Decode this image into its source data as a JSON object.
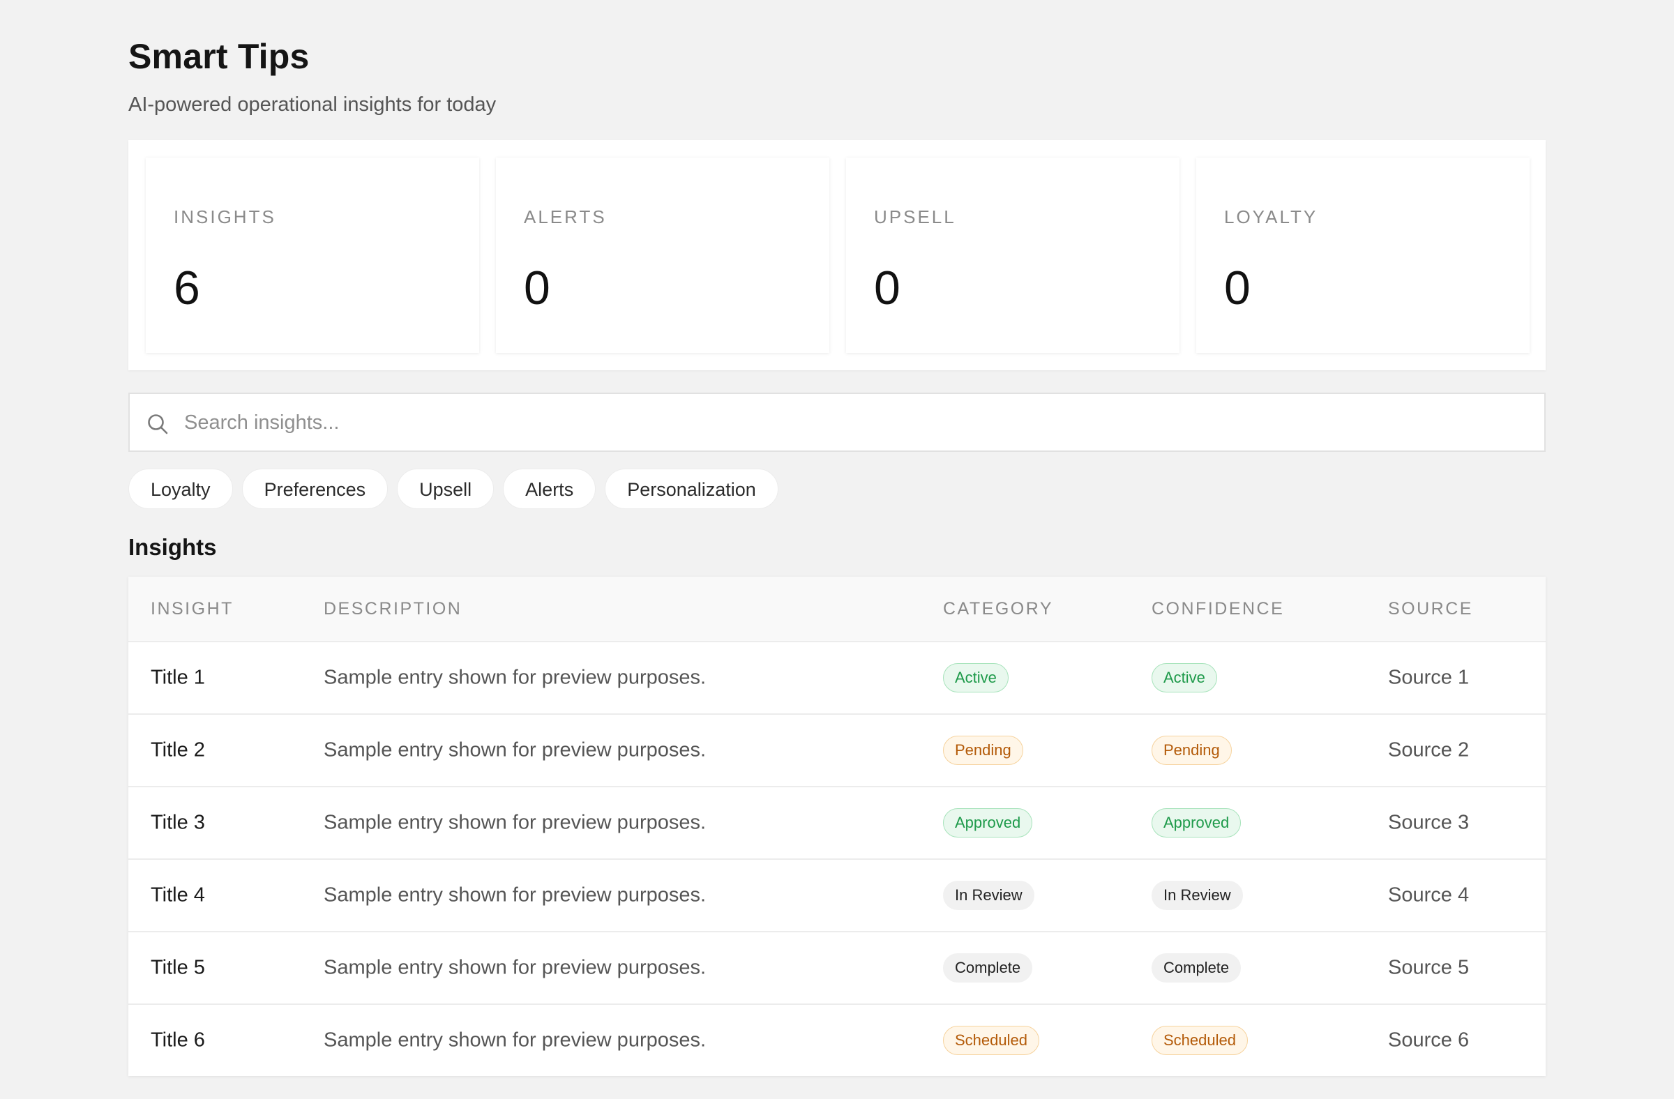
{
  "header": {
    "title": "Smart Tips",
    "subtitle": "AI-powered operational insights for today"
  },
  "stats": [
    {
      "label": "INSIGHTS",
      "value": "6"
    },
    {
      "label": "ALERTS",
      "value": "0"
    },
    {
      "label": "UPSELL",
      "value": "0"
    },
    {
      "label": "LOYALTY",
      "value": "0"
    }
  ],
  "search": {
    "placeholder": "Search insights...",
    "value": "",
    "icon": "search-icon"
  },
  "filters": [
    "Loyalty",
    "Preferences",
    "Upsell",
    "Alerts",
    "Personalization"
  ],
  "table": {
    "section_title": "Insights",
    "columns": [
      "INSIGHT",
      "DESCRIPTION",
      "CATEGORY",
      "CONFIDENCE",
      "SOURCE"
    ],
    "rows": [
      {
        "title": "Title 1",
        "description": "Sample entry shown for preview purposes.",
        "category": "Active",
        "confidence": "Active",
        "source": "Source 1",
        "tone": "green"
      },
      {
        "title": "Title 2",
        "description": "Sample entry shown for preview purposes.",
        "category": "Pending",
        "confidence": "Pending",
        "source": "Source 2",
        "tone": "orange"
      },
      {
        "title": "Title 3",
        "description": "Sample entry shown for preview purposes.",
        "category": "Approved",
        "confidence": "Approved",
        "source": "Source 3",
        "tone": "green"
      },
      {
        "title": "Title 4",
        "description": "Sample entry shown for preview purposes.",
        "category": "In Review",
        "confidence": "In Review",
        "source": "Source 4",
        "tone": "gray"
      },
      {
        "title": "Title 5",
        "description": "Sample entry shown for preview purposes.",
        "category": "Complete",
        "confidence": "Complete",
        "source": "Source 5",
        "tone": "gray"
      },
      {
        "title": "Title 6",
        "description": "Sample entry shown for preview purposes.",
        "category": "Scheduled",
        "confidence": "Scheduled",
        "source": "Source 6",
        "tone": "orange"
      }
    ]
  },
  "colors": {
    "background": "#f2f2f2",
    "badge_green": "#1e9a4a",
    "badge_orange": "#b35a08",
    "badge_gray": "#222222"
  }
}
